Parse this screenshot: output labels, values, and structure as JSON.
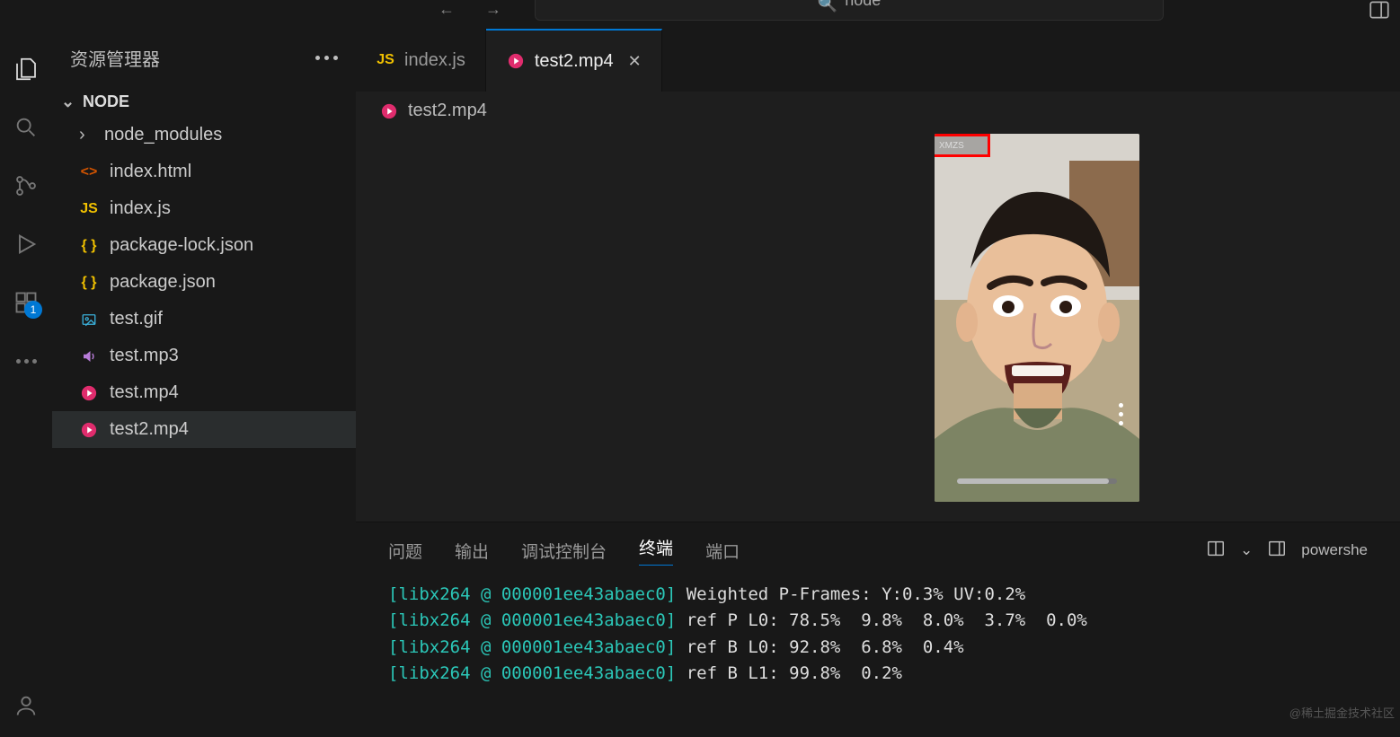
{
  "topbar": {
    "search_text": "node",
    "right_icon": "layout-icon"
  },
  "activity": {
    "badge": "1"
  },
  "sidebar": {
    "title": "资源管理器",
    "root_folder": "NODE",
    "files": [
      {
        "icon": "chevron",
        "label": "node_modules",
        "cls": "",
        "indent": true
      },
      {
        "icon": "html",
        "label": "index.html",
        "cls": "html"
      },
      {
        "icon": "js",
        "label": "index.js",
        "cls": "js"
      },
      {
        "icon": "json",
        "label": "package-lock.json",
        "cls": "json"
      },
      {
        "icon": "json",
        "label": "package.json",
        "cls": "json"
      },
      {
        "icon": "img",
        "label": "test.gif",
        "cls": "img"
      },
      {
        "icon": "snd",
        "label": "test.mp3",
        "cls": "snd"
      },
      {
        "icon": "vid",
        "label": "test.mp4",
        "cls": "vid"
      },
      {
        "icon": "vid",
        "label": "test2.mp4",
        "cls": "vid",
        "selected": true
      }
    ]
  },
  "tabs": [
    {
      "icon": "js",
      "label": "index.js",
      "cls": "js",
      "active": false
    },
    {
      "icon": "vid",
      "label": "test2.mp4",
      "cls": "vid",
      "active": true,
      "closeable": true
    }
  ],
  "breadcrumb": {
    "icon": "vid",
    "label": "test2.mp4"
  },
  "video": {
    "watermark": "XMZS"
  },
  "panel": {
    "tabs": [
      "问题",
      "输出",
      "调试控制台",
      "终端",
      "端口"
    ],
    "active_index": 3,
    "shell": "powershe",
    "lines": [
      {
        "tag": "[libx264 @ 000001ee43abaec0]",
        "rest": " Weighted P-Frames: Y:0.3% UV:0.2%"
      },
      {
        "tag": "[libx264 @ 000001ee43abaec0]",
        "rest": " ref P L0: 78.5%  9.8%  8.0%  3.7%  0.0%"
      },
      {
        "tag": "[libx264 @ 000001ee43abaec0]",
        "rest": " ref B L0: 92.8%  6.8%  0.4%"
      },
      {
        "tag": "[libx264 @ 000001ee43abaec0]",
        "rest": " ref B L1: 99.8%  0.2%"
      }
    ]
  },
  "watermark": "@稀土掘金技术社区"
}
